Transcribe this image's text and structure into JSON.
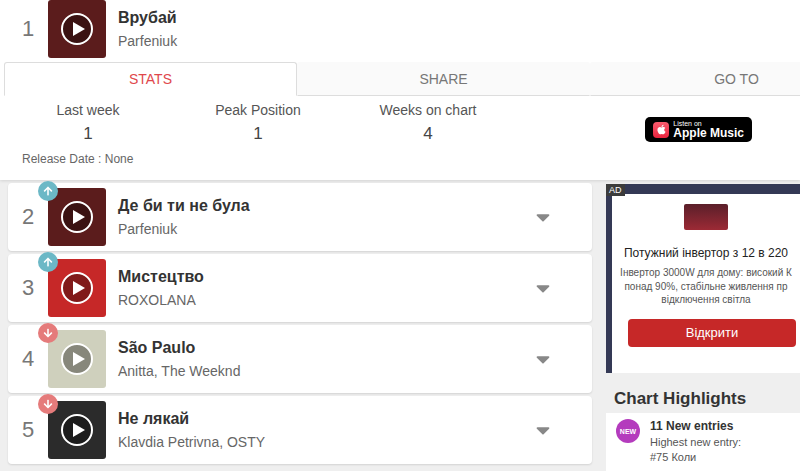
{
  "entries": [
    {
      "rank": "1",
      "title": "Врубай",
      "artist": "Parfeniuk",
      "movement": "none",
      "expanded": true,
      "color": "#5b1c1c"
    },
    {
      "rank": "2",
      "title": "Де би ти не була",
      "artist": "Parfeniuk",
      "movement": "up",
      "expanded": false,
      "color": "#5b1c1c"
    },
    {
      "rank": "3",
      "title": "Мистецтво",
      "artist": "ROXOLANA",
      "movement": "up",
      "expanded": false,
      "color": "#c62828"
    },
    {
      "rank": "4",
      "title": "São Paulo",
      "artist": "Anitta,  The Weeknd",
      "movement": "down",
      "expanded": false,
      "color": "#cfd0bd"
    },
    {
      "rank": "5",
      "title": "Не лякай",
      "artist": "Klavdia Petrivna,  OSTY",
      "movement": "down",
      "expanded": false,
      "color": "#2b2b2b"
    }
  ],
  "details": {
    "tabs": [
      {
        "label": "STATS",
        "selected": true
      },
      {
        "label": "SHARE",
        "selected": false
      },
      {
        "label": "GO TO",
        "selected": false
      }
    ],
    "stats": [
      {
        "label": "Last week",
        "value": "1"
      },
      {
        "label": "Peak Position",
        "value": "1"
      },
      {
        "label": "Weeks on chart",
        "value": "4"
      }
    ],
    "release": "Release Date : None",
    "badge": {
      "small": "Listen on",
      "large": "Apple Music"
    }
  },
  "ad": {
    "label": "AD",
    "title": "Потужний інвертор з 12 в 220",
    "lines": [
      "Інвертор 3000W для дому: високий К",
      "понад 90%, стабільне живлення пр",
      "відключення світла"
    ],
    "button": "Відкрити"
  },
  "highlights": {
    "title": "Chart Highlights",
    "badge": "NEW",
    "heading": "11 New entries",
    "caption": "Highest new entry:",
    "entry": "#75 Коли"
  }
}
